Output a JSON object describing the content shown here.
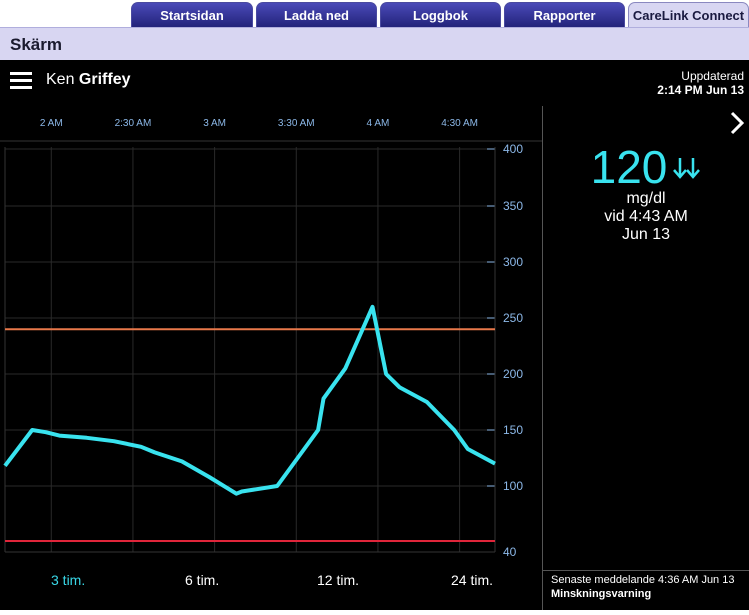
{
  "tabs": [
    {
      "label": "Startsidan",
      "active": false
    },
    {
      "label": "Ladda ned",
      "active": false
    },
    {
      "label": "Loggbok",
      "active": false
    },
    {
      "label": "Rapporter",
      "active": false
    },
    {
      "label": "CareLink Connect",
      "active": true
    }
  ],
  "header": {
    "title": "Skärm"
  },
  "patient": {
    "first_name": "Ken",
    "last_name": "Griffey"
  },
  "updated": {
    "label": "Uppdaterad",
    "time": "2:14 PM Jun 13"
  },
  "reading": {
    "value": "120",
    "unit": "mg/dl",
    "at": "vid 4:43 AM",
    "date": "Jun 13",
    "trend_icon": "double-down-arrow-icon"
  },
  "ranges": [
    {
      "label": "3 tim.",
      "active": true
    },
    {
      "label": "6 tim.",
      "active": false
    },
    {
      "label": "12 tim.",
      "active": false
    },
    {
      "label": "24 tim.",
      "active": false
    }
  ],
  "alert": {
    "prefix": "Senaste meddelande 4:36 AM Jun 13",
    "message": "Minskningsvarning"
  },
  "colors": {
    "sensor_line": "#39e3ef",
    "high_limit": "#e8784a",
    "low_limit": "#e0253a",
    "axis_text": "#8cb8e8"
  },
  "chart_data": {
    "type": "line",
    "x_ticks": [
      "2 AM",
      "2:30 AM",
      "3 AM",
      "3:30 AM",
      "4 AM",
      "4:30 AM"
    ],
    "y_ticks": [
      400,
      350,
      300,
      250,
      200,
      150,
      100,
      40
    ],
    "ylim": [
      40,
      400
    ],
    "high_limit": 240,
    "low_limit": 50,
    "grid": true,
    "series": [
      {
        "x": [
          "1:43 AM",
          "1:53 AM",
          "1:58 AM",
          "2:03 AM",
          "2:13 AM",
          "2:23 AM",
          "2:33 AM",
          "2:38 AM",
          "2:48 AM",
          "2:58 AM",
          "3:08 AM",
          "3:10 AM",
          "3:23 AM",
          "3:38 AM",
          "3:40 AM",
          "3:48 AM",
          "3:58 AM",
          "4:03 AM",
          "4:08 AM",
          "4:18 AM",
          "4:28 AM",
          "4:33 AM",
          "4:43 AM"
        ],
        "values": [
          118,
          150,
          148,
          145,
          143,
          140,
          135,
          130,
          122,
          108,
          93,
          95,
          100,
          150,
          178,
          205,
          260,
          200,
          188,
          175,
          150,
          133,
          120
        ]
      }
    ]
  }
}
